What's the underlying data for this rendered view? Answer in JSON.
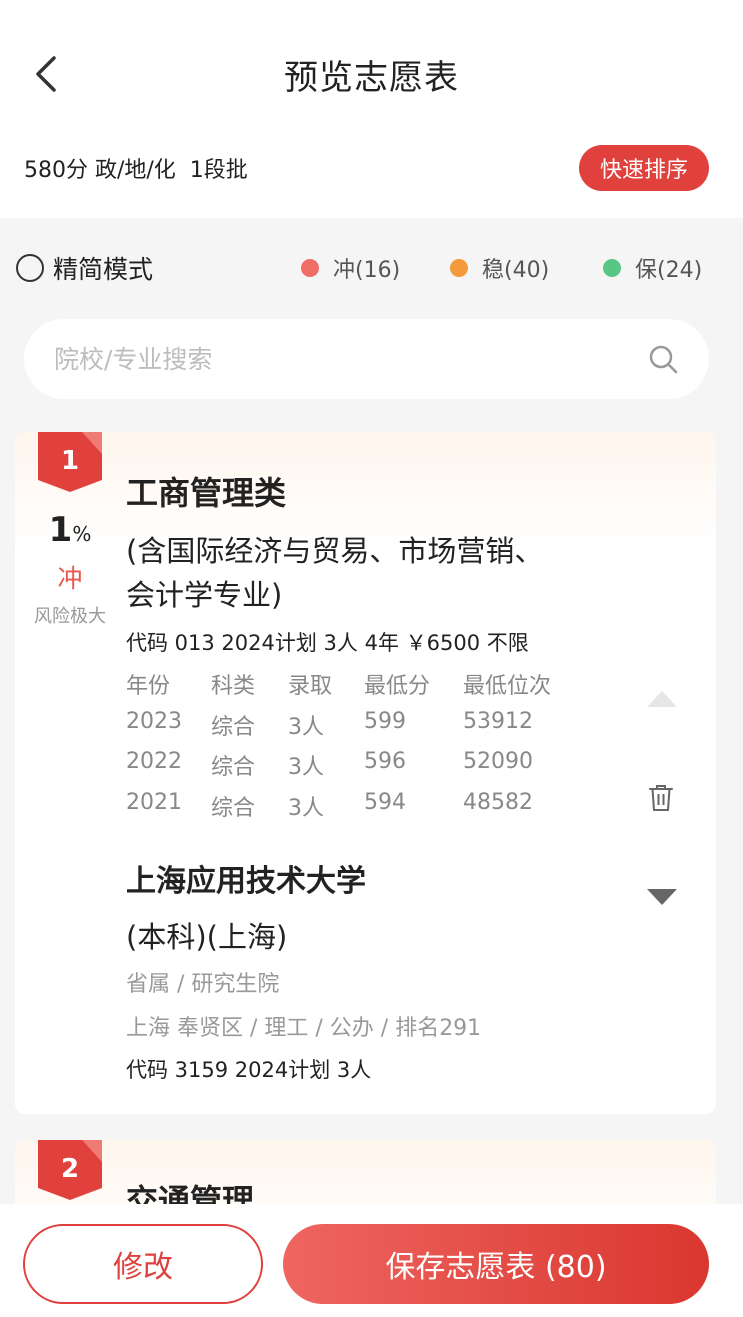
{
  "header": {
    "title": "预览志愿表",
    "score_info": "580分 政/地/化  1段批",
    "quick_sort_label": "快速排序"
  },
  "filters": {
    "mode_label": "精简模式",
    "legend": [
      {
        "label": "冲(16)",
        "color": "#f06d66"
      },
      {
        "label": "稳(40)",
        "color": "#f29a3c"
      },
      {
        "label": "保(24)",
        "color": "#57c786"
      }
    ]
  },
  "search": {
    "placeholder": "院校/专业搜索"
  },
  "cards": [
    {
      "rank": "1",
      "probability": "1",
      "probability_unit": "%",
      "risk_type": "冲",
      "risk_desc": "风险极大",
      "major_name": "工商管理类",
      "major_note_line1": "(含国际经济与贸易、市场营销、",
      "major_note_line2": "会计学专业)",
      "major_code_info": "代码 013 2024计划 3人 4年 ￥6500 不限",
      "history_headers": [
        "年份",
        "科类",
        "录取",
        "最低分",
        "最低位次"
      ],
      "history_rows": [
        [
          "2023",
          "综合",
          "3人",
          "599",
          "53912"
        ],
        [
          "2022",
          "综合",
          "3人",
          "596",
          "52090"
        ],
        [
          "2021",
          "综合",
          "3人",
          "594",
          "48582"
        ]
      ],
      "school_name": "上海应用技术大学",
      "school_type": "(本科)(上海)",
      "school_attr1": "省属 / 研究生院",
      "school_attr2": "上海 奉贤区 / 理工 / 公办 / 排名291",
      "school_code_info": "代码 3159 2024计划 3人"
    },
    {
      "rank": "2",
      "major_name": "交通管理"
    }
  ],
  "footer": {
    "modify_label": "修改",
    "save_label": "保存志愿表 (80)"
  },
  "colors": {
    "accent": "#e0413c",
    "risk": "#e8564d"
  }
}
